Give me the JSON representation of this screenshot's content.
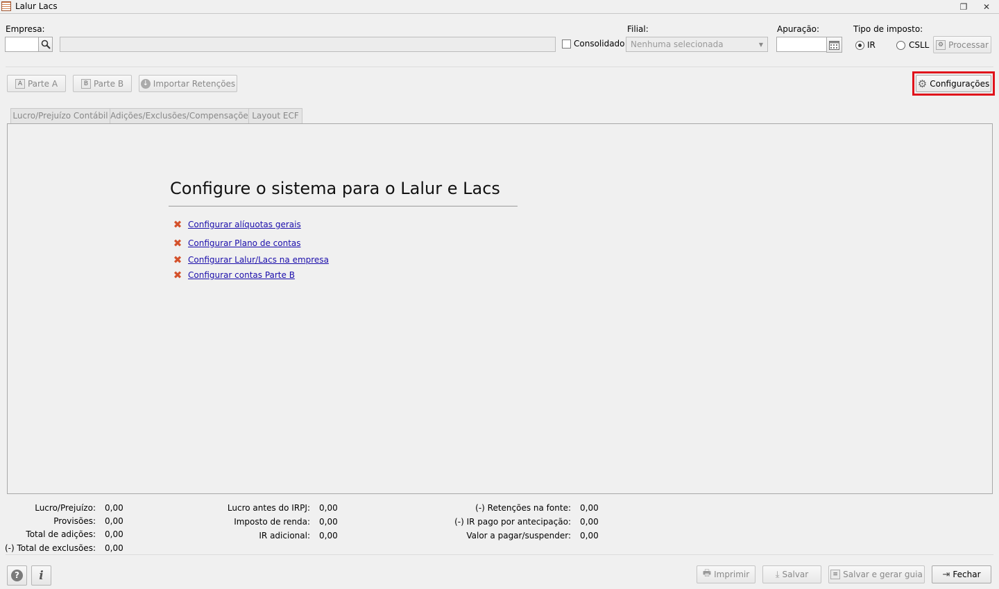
{
  "window": {
    "title": "Lalur Lacs",
    "icon": "ledger-icon",
    "restore_icon": "restore-icon",
    "close_icon": "close-icon"
  },
  "filters": {
    "empresa_label": "Empresa:",
    "empresa_code": "",
    "empresa_name": "",
    "consolidado_label": "Consolidado",
    "consolidado_checked": false,
    "filial_label": "Filial:",
    "filial_value": "Nenhuma selecionada",
    "apuracao_label": "Apuração:",
    "apuracao_value": "",
    "tipo_label": "Tipo de imposto:",
    "tipo_options": [
      "IR",
      "CSLL"
    ],
    "tipo_selected": "IR",
    "processar_label": "Processar"
  },
  "toolbar": {
    "parte_a": "Parte A",
    "parte_b": "Parte B",
    "importar": "Importar Retenções",
    "configuracoes": "Configurações"
  },
  "tabs": [
    {
      "label": "Lucro/Prejuízo Contábil"
    },
    {
      "label": "Adições/Exclusões/Compensações"
    },
    {
      "label": "Layout ECF"
    }
  ],
  "setup": {
    "heading": "Configure o sistema para o Lalur e Lacs",
    "tasks": [
      {
        "label": "Configurar alíquotas gerais",
        "done": false
      },
      {
        "label": "Configurar Plano de contas",
        "done": false
      },
      {
        "label": "Configurar Lalur/Lacs na empresa",
        "done": false
      },
      {
        "label": "Configurar contas Parte B",
        "done": false
      }
    ]
  },
  "summary": {
    "col1": [
      {
        "label": "Lucro/Prejuízo:",
        "value": "0,00"
      },
      {
        "label": "Provisões:",
        "value": "0,00"
      },
      {
        "label": "Total de adições:",
        "value": "0,00"
      },
      {
        "label": "(-) Total de exclusões:",
        "value": "0,00"
      }
    ],
    "col2": [
      {
        "label": "Lucro antes do IRPJ:",
        "value": "0,00"
      },
      {
        "label": "Imposto de renda:",
        "value": "0,00"
      },
      {
        "label": "IR adicional:",
        "value": "0,00"
      }
    ],
    "col3": [
      {
        "label": "(-) Retenções na fonte:",
        "value": "0,00"
      },
      {
        "label": "(-) IR pago por antecipação:",
        "value": "0,00"
      },
      {
        "label": "Valor a pagar/suspender:",
        "value": "0,00"
      }
    ]
  },
  "footer": {
    "help_icon": "help-icon",
    "info_icon": "info-icon",
    "imprimir": "Imprimir",
    "salvar": "Salvar",
    "salvar_guia": "Salvar e gerar guia",
    "fechar": "Fechar"
  },
  "colors": {
    "highlight": "#e0121b",
    "link": "#1a0dab",
    "task_pending": "#d4512b"
  }
}
